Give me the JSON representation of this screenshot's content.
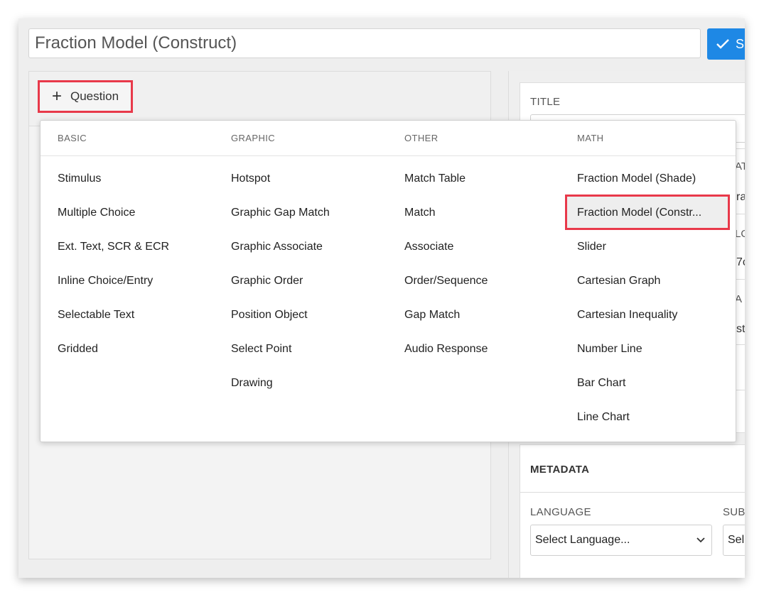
{
  "title_field": {
    "value": "Fraction Model (Construct)"
  },
  "save_button": {
    "label": "S"
  },
  "left_toolbar": {
    "add_question_label": "Question"
  },
  "right_panel": {
    "title_label": "TITLE",
    "partials": [
      "AT",
      "ra",
      "LO",
      "7c",
      "A",
      "st"
    ],
    "metadata_label": "METADATA",
    "language_label": "LANGUAGE",
    "language_value": "Select Language...",
    "subject_label": "SUB",
    "subject_value": "Sel"
  },
  "dropdown": {
    "columns": [
      {
        "title": "BASIC",
        "items": [
          "Stimulus",
          "Multiple Choice",
          "Ext. Text, SCR & ECR",
          "Inline Choice/Entry",
          "Selectable Text",
          "Gridded"
        ]
      },
      {
        "title": "GRAPHIC",
        "items": [
          "Hotspot",
          "Graphic Gap Match",
          "Graphic Associate",
          "Graphic Order",
          "Position Object",
          "Select Point",
          "Drawing"
        ]
      },
      {
        "title": "OTHER",
        "items": [
          "Match Table",
          "Match",
          "Associate",
          "Order/Sequence",
          "Gap Match",
          "Audio Response"
        ]
      },
      {
        "title": "MATH",
        "items": [
          "Fraction Model (Shade)",
          "Fraction Model (Constr...",
          "Slider",
          "Cartesian Graph",
          "Cartesian Inequality",
          "Number Line",
          "Bar Chart",
          "Line Chart"
        ]
      }
    ],
    "highlighted_item": "Fraction Model (Constr..."
  },
  "colors": {
    "accent": "#1e88e5",
    "highlight_border": "#e8394a"
  }
}
